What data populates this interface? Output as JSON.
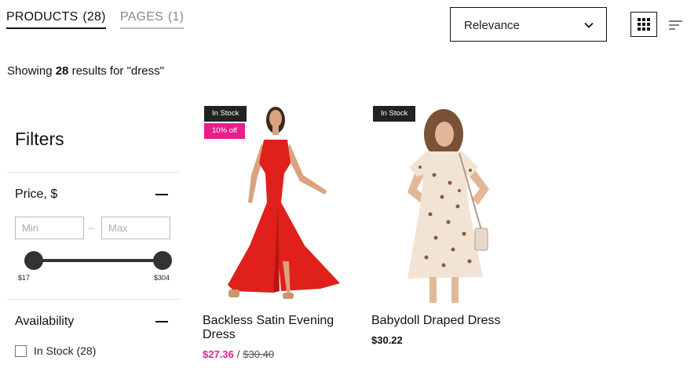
{
  "tabs": [
    {
      "label": "PRODUCTS",
      "count": "(28)",
      "active": true
    },
    {
      "label": "PAGES",
      "count": "(1)",
      "active": false
    }
  ],
  "sort": {
    "selected": "Relevance",
    "icon": "chevron-down-icon"
  },
  "view_toggles": {
    "grid_icon": "grid-icon",
    "list_icon": "list-icon"
  },
  "results": {
    "prefix": "Showing ",
    "count": "28",
    "suffix": " results for \"dress\""
  },
  "filters": {
    "title": "Filters",
    "price": {
      "title": "Price, $",
      "min_placeholder": "Min",
      "max_placeholder": "Max",
      "dash": "–",
      "min_label": "$17",
      "max_label": "$304"
    },
    "availability": {
      "title": "Availability",
      "options": [
        {
          "label": "In Stock (28)",
          "checked": false
        }
      ]
    }
  },
  "products": [
    {
      "name": "Backless Satin Evening Dress",
      "badges": [
        "In Stock",
        "10% off"
      ],
      "sale_price": "$27.36",
      "separator": "/",
      "original_price": "$30.40"
    },
    {
      "name": "Babydoll Draped Dress",
      "badges": [
        "In Stock"
      ],
      "price": "$30.22"
    }
  ],
  "colors": {
    "accent": "#e91e8c",
    "dark": "#222222"
  }
}
